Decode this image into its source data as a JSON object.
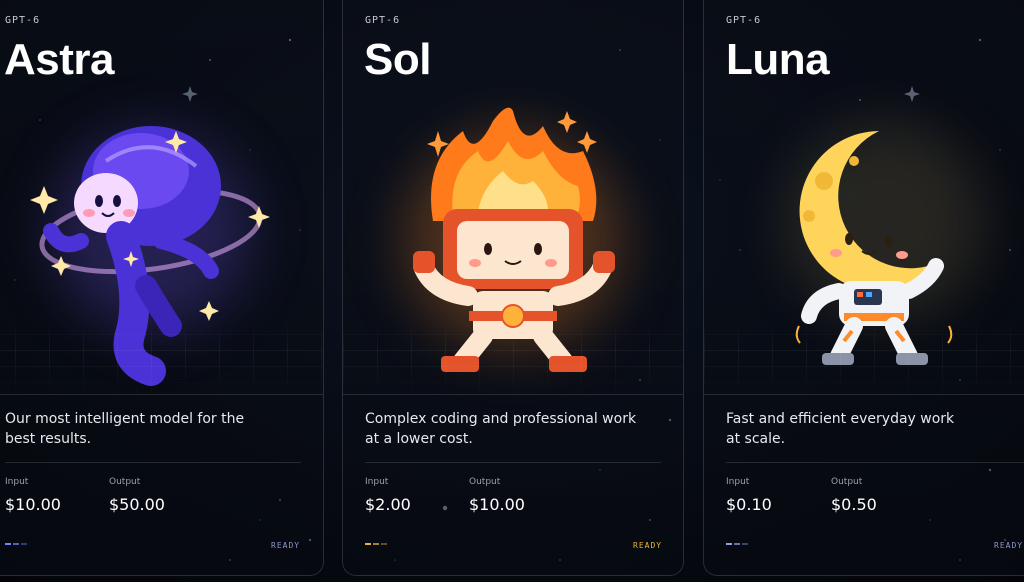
{
  "cards": [
    {
      "brand": "GPT-6",
      "name": "Astra",
      "description_line1": "Our most intelligent model for the",
      "description_line2": "best results.",
      "input_label": "Input",
      "input_price": "$10.00",
      "output_label": "Output",
      "output_price": "$50.00",
      "status": "READY",
      "accent": "#6f86ff"
    },
    {
      "brand": "GPT-6",
      "name": "Sol",
      "description_line1": "Complex coding and professional work",
      "description_line2": "at a lower cost.",
      "input_label": "Input",
      "input_price": "$2.00",
      "output_label": "Output",
      "output_price": "$10.00",
      "status": "READY",
      "accent": "#e8b43a"
    },
    {
      "brand": "GPT-6",
      "name": "Luna",
      "description_line1": "Fast and efficient everyday work",
      "description_line2": "at scale.",
      "input_label": "Input",
      "input_price": "$0.10",
      "output_label": "Output",
      "output_price": "$0.50",
      "status": "READY",
      "accent": "#8fa3d8"
    }
  ]
}
